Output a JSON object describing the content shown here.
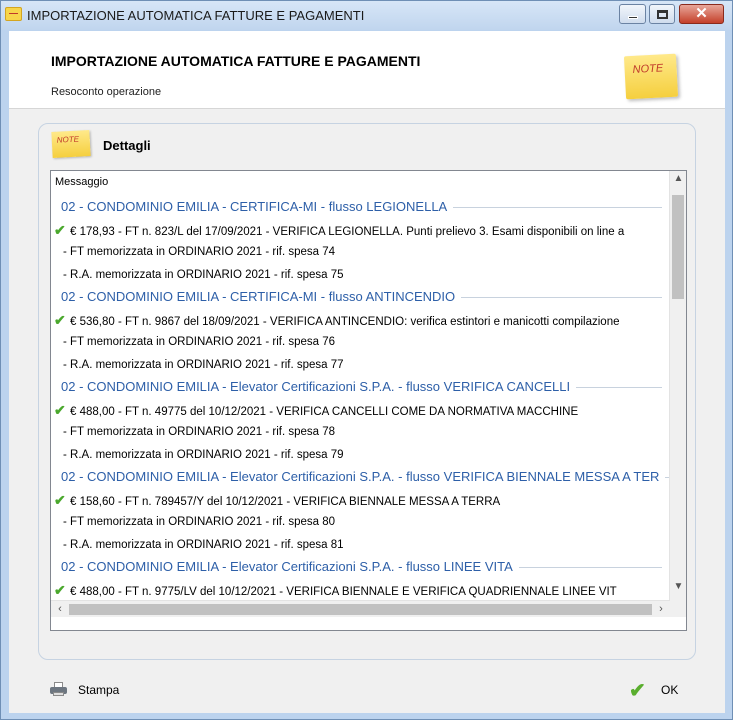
{
  "window": {
    "title": "IMPORTAZIONE AUTOMATICA FATTURE E PAGAMENTI",
    "app_icon": "note-icon"
  },
  "header": {
    "title": "IMPORTAZIONE AUTOMATICA FATTURE E PAGAMENTI",
    "subtitle": "Resoconto operazione",
    "note_label": "NOTE"
  },
  "group": {
    "title": "Dettagli",
    "note_label": "NOTE"
  },
  "list": {
    "header": "Messaggio",
    "rows": [
      {
        "type": "head",
        "text": "02 - CONDOMINIO EMILIA - CERTIFICA-MI - flusso LEGIONELLA"
      },
      {
        "type": "amount",
        "text": "€ 178,93 - FT n. 823/L del 17/09/2021 - VERIFICA LEGIONELLA. Punti prelievo 3. Esami disponibili on line a"
      },
      {
        "type": "sub",
        "text": "- FT memorizzata in ORDINARIO 2021 - rif. spesa 74"
      },
      {
        "type": "sub",
        "text": "- R.A. memorizzata in ORDINARIO 2021 - rif. spesa 75"
      },
      {
        "type": "head",
        "text": "02 - CONDOMINIO EMILIA - CERTIFICA-MI - flusso ANTINCENDIO"
      },
      {
        "type": "amount",
        "text": "€ 536,80 - FT n. 9867 del 18/09/2021 - VERIFICA ANTINCENDIO: verifica estintori e manicotti compilazione"
      },
      {
        "type": "sub",
        "text": "- FT memorizzata in ORDINARIO 2021 - rif. spesa 76"
      },
      {
        "type": "sub",
        "text": "- R.A. memorizzata in ORDINARIO 2021 - rif. spesa 77"
      },
      {
        "type": "head",
        "text": "02 - CONDOMINIO EMILIA - Elevator Certificazioni S.P.A. - flusso VERIFICA CANCELLI"
      },
      {
        "type": "amount",
        "text": "€ 488,00 - FT n. 49775 del 10/12/2021 - VERIFICA CANCELLI COME DA NORMATIVA MACCHINE"
      },
      {
        "type": "sub",
        "text": "- FT memorizzata in ORDINARIO 2021 - rif. spesa 78"
      },
      {
        "type": "sub",
        "text": "- R.A. memorizzata in ORDINARIO 2021 - rif. spesa 79"
      },
      {
        "type": "head",
        "text": "02 - CONDOMINIO EMILIA - Elevator Certificazioni S.P.A. - flusso VERIFICA BIENNALE MESSA A TER"
      },
      {
        "type": "amount",
        "text": "€ 158,60 - FT n. 789457/Y del 10/12/2021 - VERIFICA BIENNALE MESSA A TERRA"
      },
      {
        "type": "sub",
        "text": "- FT memorizzata in ORDINARIO 2021 - rif. spesa 80"
      },
      {
        "type": "sub",
        "text": "- R.A. memorizzata in ORDINARIO 2021 - rif. spesa 81"
      },
      {
        "type": "head",
        "text": "02 - CONDOMINIO EMILIA - Elevator Certificazioni S.P.A. - flusso LINEE VITA"
      },
      {
        "type": "amount",
        "text": "€ 488,00 - FT n. 9775/LV del 10/12/2021 - VERIFICA BIENNALE E VERIFICA QUADRIENNALE LINEE VIT"
      }
    ]
  },
  "footer": {
    "print_label": "Stampa",
    "ok_label": "OK"
  },
  "colors": {
    "heading_blue": "#2d5fa8",
    "check_green": "#4aa82d"
  }
}
